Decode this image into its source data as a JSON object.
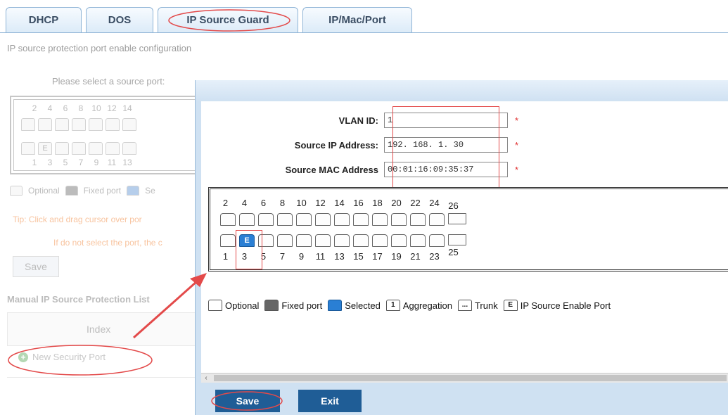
{
  "tabs": [
    {
      "label": "DHCP"
    },
    {
      "label": "DOS"
    },
    {
      "label": "IP Source Guard"
    },
    {
      "label": "IP/Mac/Port"
    }
  ],
  "page": {
    "subtitle": "IP source protection port enable configuration",
    "select_port_label": "Please select a source port:",
    "ports_top": [
      "2",
      "4",
      "6",
      "8",
      "10",
      "12",
      "14"
    ],
    "ports_bottom": [
      "1",
      "3",
      "5",
      "7",
      "9",
      "11",
      "13"
    ],
    "port_mark": "E",
    "legend_optional": "Optional",
    "legend_fixed": "Fixed port",
    "legend_selected_partial": "Se",
    "tip": "Tip: Click and drag cursor over por",
    "tip2": "If do not select the port, the c",
    "save_label": "Save",
    "list_title": "Manual IP Source Protection List",
    "index_header": "Index",
    "new_security_port": "New Security Port"
  },
  "dialog": {
    "vlan_label": "VLAN ID:",
    "vlan_value": "1",
    "ip_label": "Source IP Address:",
    "ip_value": "192. 168. 1. 30",
    "mac_label": "Source MAC Address",
    "mac_value": "00:01:16:09:35:37",
    "required_mark": "*",
    "ports_top": [
      "2",
      "4",
      "6",
      "8",
      "10",
      "12",
      "14",
      "16",
      "18",
      "20",
      "22",
      "24",
      "26"
    ],
    "ports_bottom": [
      "1",
      "3",
      "5",
      "7",
      "9",
      "11",
      "13",
      "15",
      "17",
      "19",
      "21",
      "23",
      "25"
    ],
    "selected_port_mark": "E",
    "legend": {
      "optional": "Optional",
      "fixed": "Fixed port",
      "selected": "Selected",
      "aggregation_mark": "1",
      "aggregation": "Aggregation",
      "trunk_mark": "...",
      "trunk": "Trunk",
      "ip_source_mark": "E",
      "ip_source": "IP Source Enable Port"
    },
    "save_label": "Save",
    "exit_label": "Exit"
  },
  "colors": {
    "accent": "#1f5d96",
    "selected_port": "#2a7fd4",
    "annotation": "#e34a4a"
  }
}
